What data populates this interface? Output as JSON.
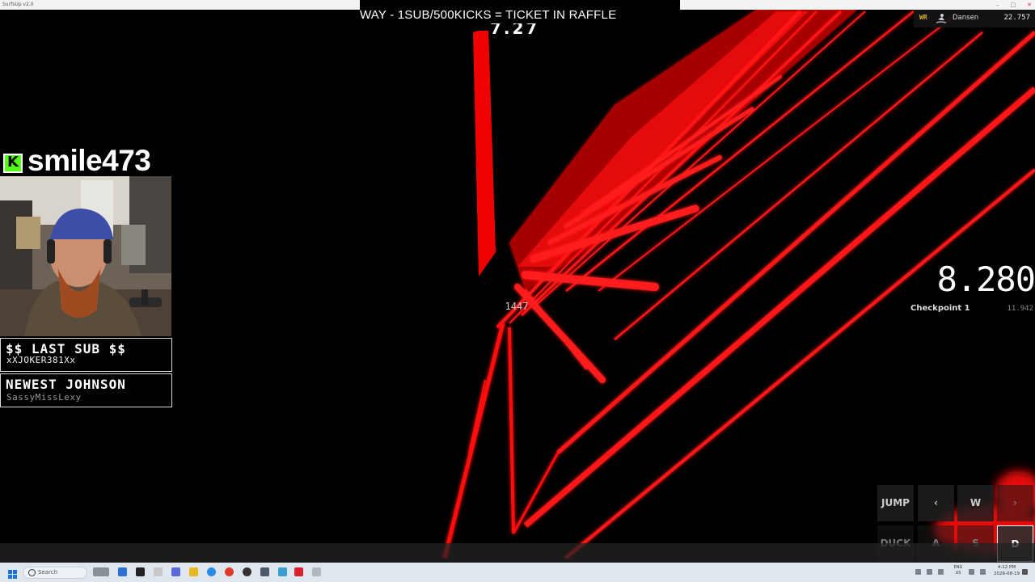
{
  "window": {
    "title": "SurfsUp v2.0"
  },
  "stream": {
    "banner": "WAY - 1SUB/500KICKS = TICKET IN RAFFLE",
    "streamer": "smile473",
    "platform_badge": "K",
    "last_sub": {
      "label": "$$ LAST SUB $$",
      "name": "xXJOKER381Xx"
    },
    "newest": {
      "label": "NEWEST JOHNSON",
      "name": "SassyMissLexy"
    }
  },
  "hud": {
    "top_timer": "7.27",
    "world_record": {
      "tag": "WR",
      "player": "Dansen",
      "time": "22.757"
    },
    "run_timer": "8.280",
    "checkpoint": {
      "label": "Checkpoint 1",
      "time": "11.942"
    },
    "speed": "1447"
  },
  "keys": [
    {
      "name": "key-jump",
      "label": "JUMP",
      "state": "idle"
    },
    {
      "name": "key-left-arrow",
      "label": "‹",
      "state": "idle"
    },
    {
      "name": "key-w",
      "label": "W",
      "state": "idle"
    },
    {
      "name": "key-right-arrow",
      "label": "›",
      "state": "dim"
    },
    {
      "name": "key-duck",
      "label": "DUCK",
      "state": "dim"
    },
    {
      "name": "key-a",
      "label": "A",
      "state": "dim"
    },
    {
      "name": "key-s",
      "label": "S",
      "state": "dim"
    },
    {
      "name": "key-d",
      "label": "D",
      "state": "pressed"
    }
  ],
  "taskbar": {
    "search_placeholder": "Search",
    "clock_time": "4:12 PM",
    "clock_date": "2026-08-19",
    "language": "ENG US"
  },
  "colors": {
    "ramp_red": "#ff1010",
    "kick_green": "#53fc18",
    "wr_gold": "#e0b030"
  }
}
